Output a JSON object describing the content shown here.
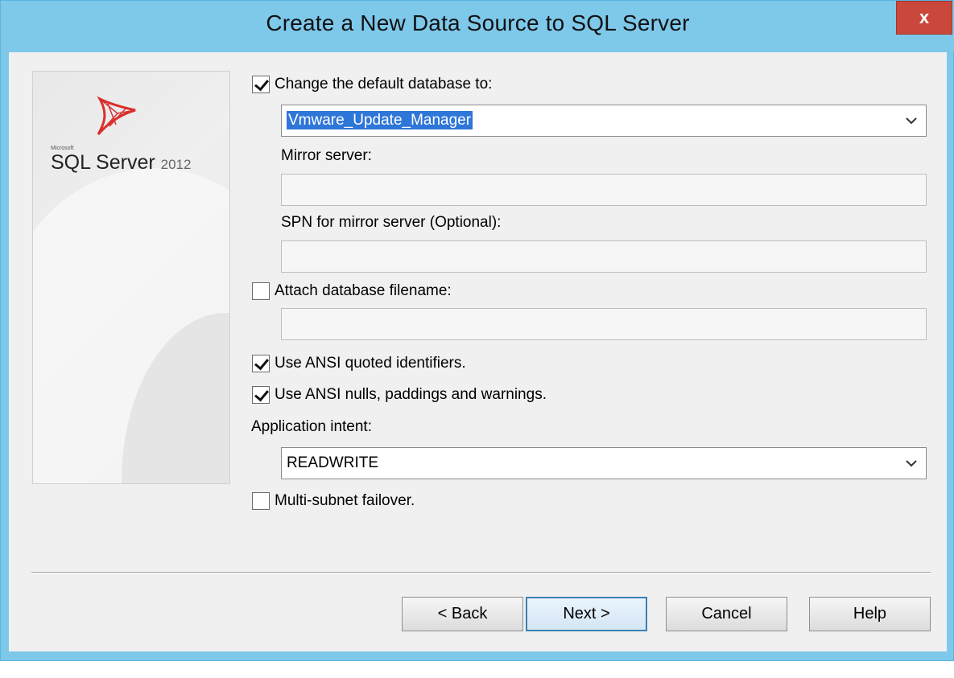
{
  "window": {
    "title": "Create a New Data Source to SQL Server",
    "close_label": "x"
  },
  "side_panel": {
    "brand": "Microsoft",
    "product": "SQL Server",
    "version": "2012"
  },
  "form": {
    "change_default_db": {
      "label": "Change the default database to:",
      "checked": true
    },
    "default_db_value": "Vmware_Update_Manager",
    "mirror_server": {
      "label": "Mirror server:",
      "value": ""
    },
    "spn_mirror": {
      "label": "SPN for mirror server (Optional):",
      "value": ""
    },
    "attach_db_filename": {
      "label": "Attach database filename:",
      "checked": false,
      "value": ""
    },
    "ansi_quoted": {
      "label": "Use ANSI quoted identifiers.",
      "checked": true
    },
    "ansi_nulls": {
      "label": "Use ANSI nulls, paddings and warnings.",
      "checked": true
    },
    "application_intent": {
      "label": "Application intent:",
      "value": "READWRITE"
    },
    "multi_subnet": {
      "label": "Multi-subnet failover.",
      "checked": false
    }
  },
  "buttons": {
    "back": "< Back",
    "next": "Next >",
    "cancel": "Cancel",
    "help": "Help"
  },
  "colors": {
    "titlebar": "#7ec8ea",
    "close": "#c9483b",
    "selection": "#2e76d8",
    "dialog_bg": "#f0f0f0"
  }
}
